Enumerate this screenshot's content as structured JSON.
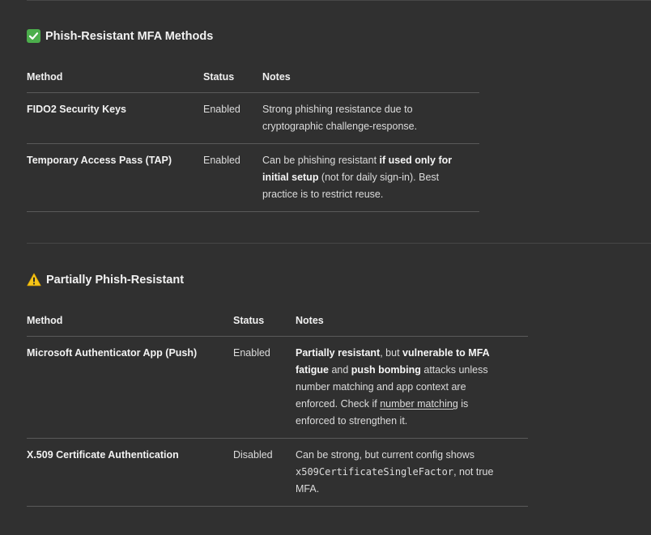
{
  "sections": [
    {
      "title": "Phish-Resistant MFA Methods",
      "icon": "check-mark-icon",
      "headers": {
        "method": "Method",
        "status": "Status",
        "notes": "Notes"
      },
      "rows": [
        {
          "method": "FIDO2 Security Keys",
          "status": "Enabled",
          "notes": {
            "line1": "Strong phishing resistance due to",
            "line2": "cryptographic challenge-response."
          }
        },
        {
          "method": "Temporary Access Pass (TAP)",
          "status": "Enabled",
          "notes": {
            "plain1": "Can be phishing resistant ",
            "bold1": "if used only for",
            "bold2": "initial setup",
            "plain2": " (not for daily sign-in). Best",
            "plain3": "practice is to restrict reuse."
          }
        }
      ]
    },
    {
      "title": "Partially Phish-Resistant",
      "icon": "warning-icon",
      "headers": {
        "method": "Method",
        "status": "Status",
        "notes": "Notes"
      },
      "rows": [
        {
          "method": "Microsoft Authenticator App (Push)",
          "status": "Enabled",
          "notes": {
            "bold1": "Partially resistant",
            "plain1": ", but ",
            "bold2": "vulnerable to MFA",
            "bold3": "fatigue",
            "plain2": " and ",
            "bold4": "push bombing",
            "plain3": " attacks unless",
            "plain4": "number matching and app context are",
            "plain5": "enforced. Check if ",
            "link": "number matching",
            "plain6": " is",
            "plain7": "enforced to strengthen it."
          }
        },
        {
          "method": "X.509 Certificate Authentication",
          "status": "Disabled",
          "notes": {
            "plain1": "Can be strong, but current config shows",
            "code": "x509CertificateSingleFactor",
            "plain2": ", not true",
            "plain3": "MFA."
          }
        }
      ]
    }
  ]
}
